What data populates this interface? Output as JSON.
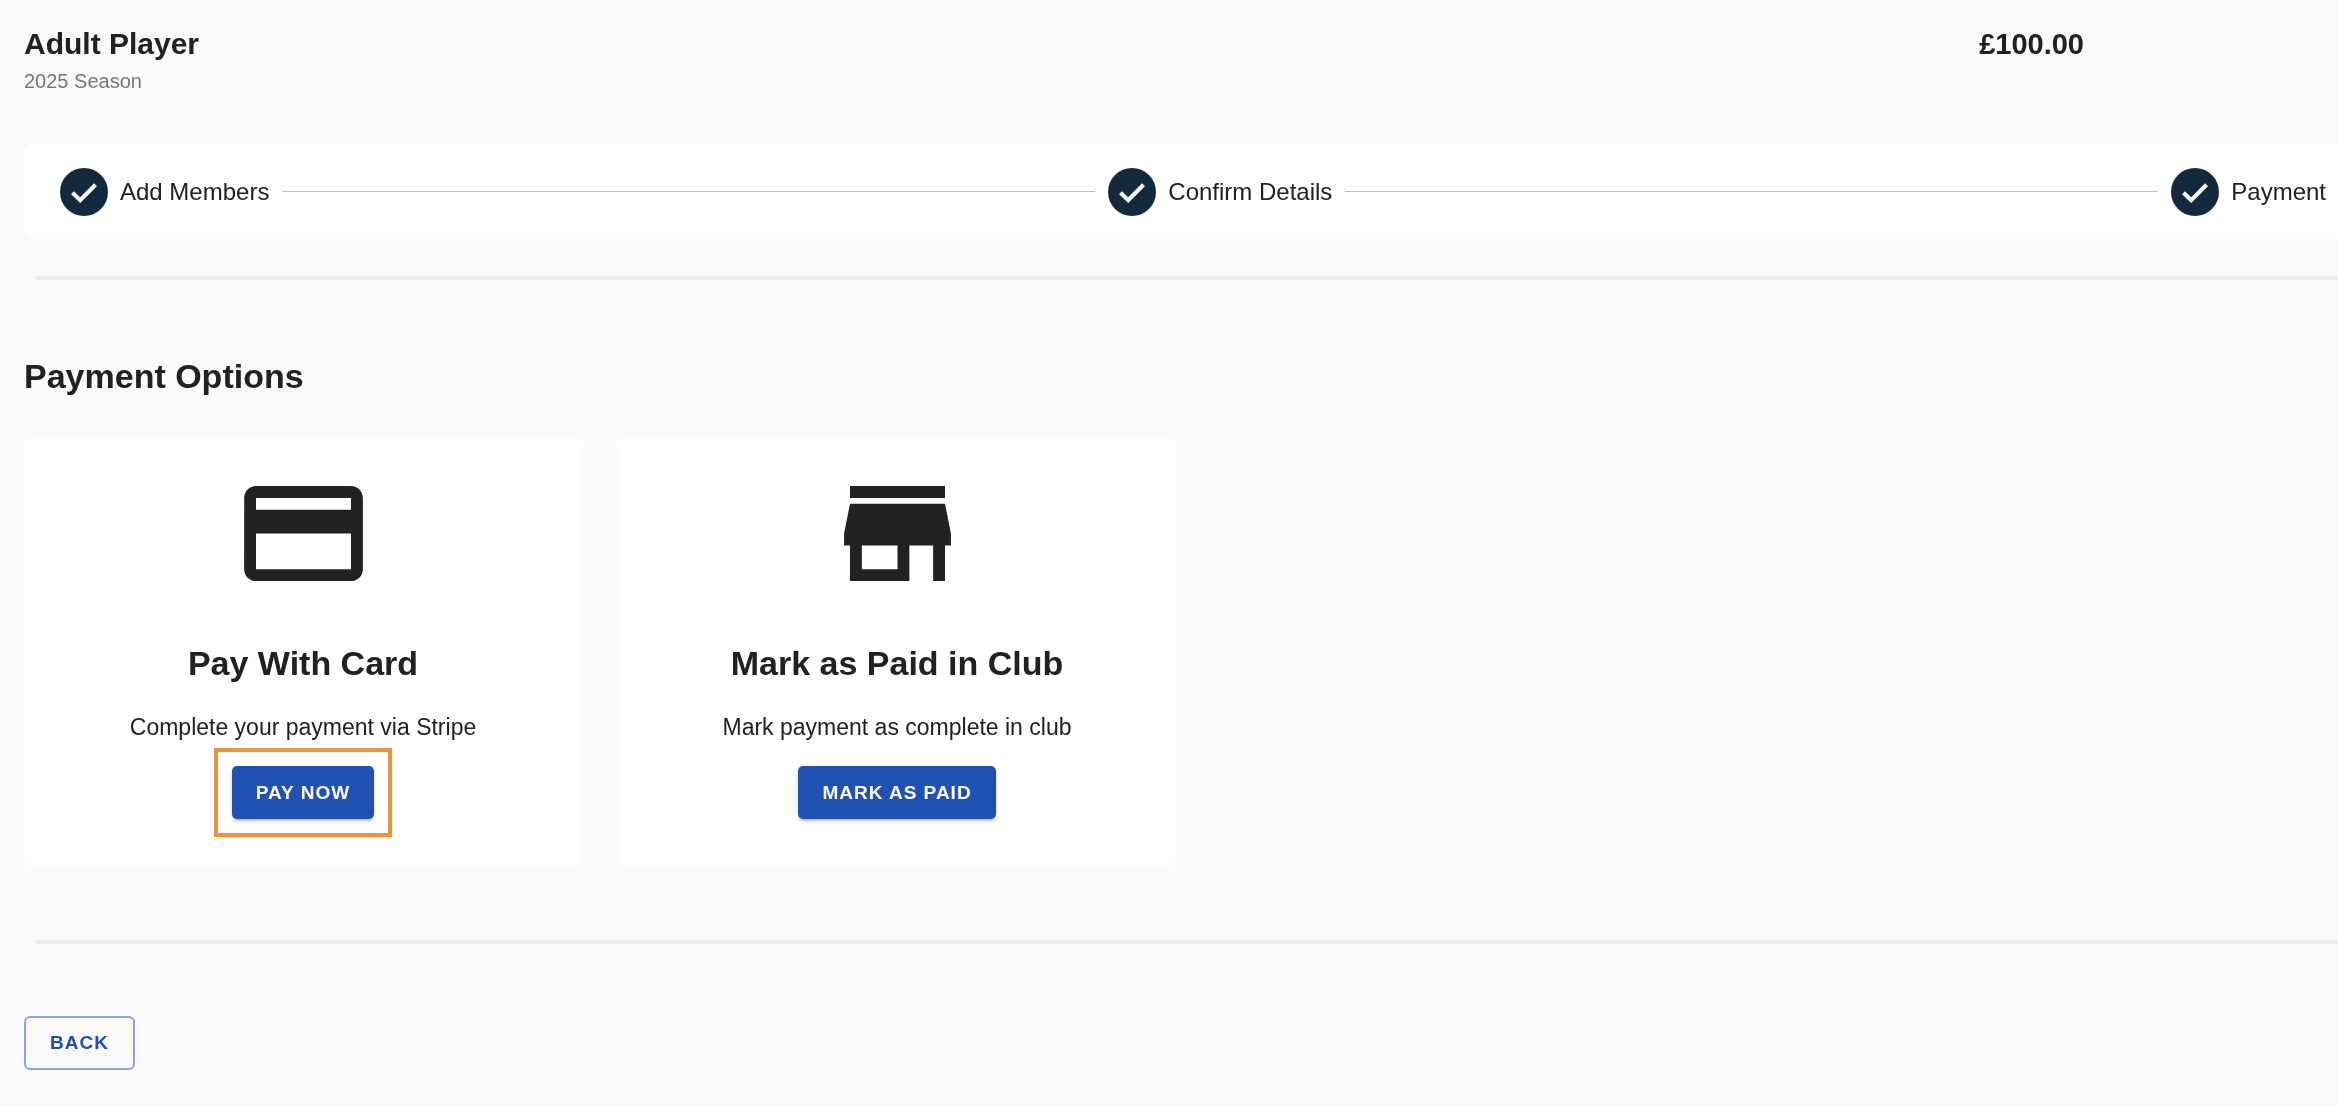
{
  "header": {
    "title": "Adult Player",
    "subtitle": "2025 Season",
    "price": "£100.00"
  },
  "stepper": {
    "steps": [
      {
        "label": "Add Members",
        "completed": true
      },
      {
        "label": "Confirm Details",
        "completed": true
      },
      {
        "label": "Payment",
        "completed": true
      }
    ]
  },
  "payment_options": {
    "heading": "Payment Options",
    "options": [
      {
        "kind": "card",
        "title": "Pay With Card",
        "description": "Complete your payment via Stripe",
        "button": {
          "label": "PAY NOW",
          "highlighted": true
        }
      },
      {
        "kind": "store",
        "title": "Mark as Paid in Club",
        "description": "Mark payment as complete in club",
        "button": {
          "label": "MARK AS PAID",
          "highlighted": false
        }
      }
    ]
  },
  "footer": {
    "back_button": "BACK"
  }
}
